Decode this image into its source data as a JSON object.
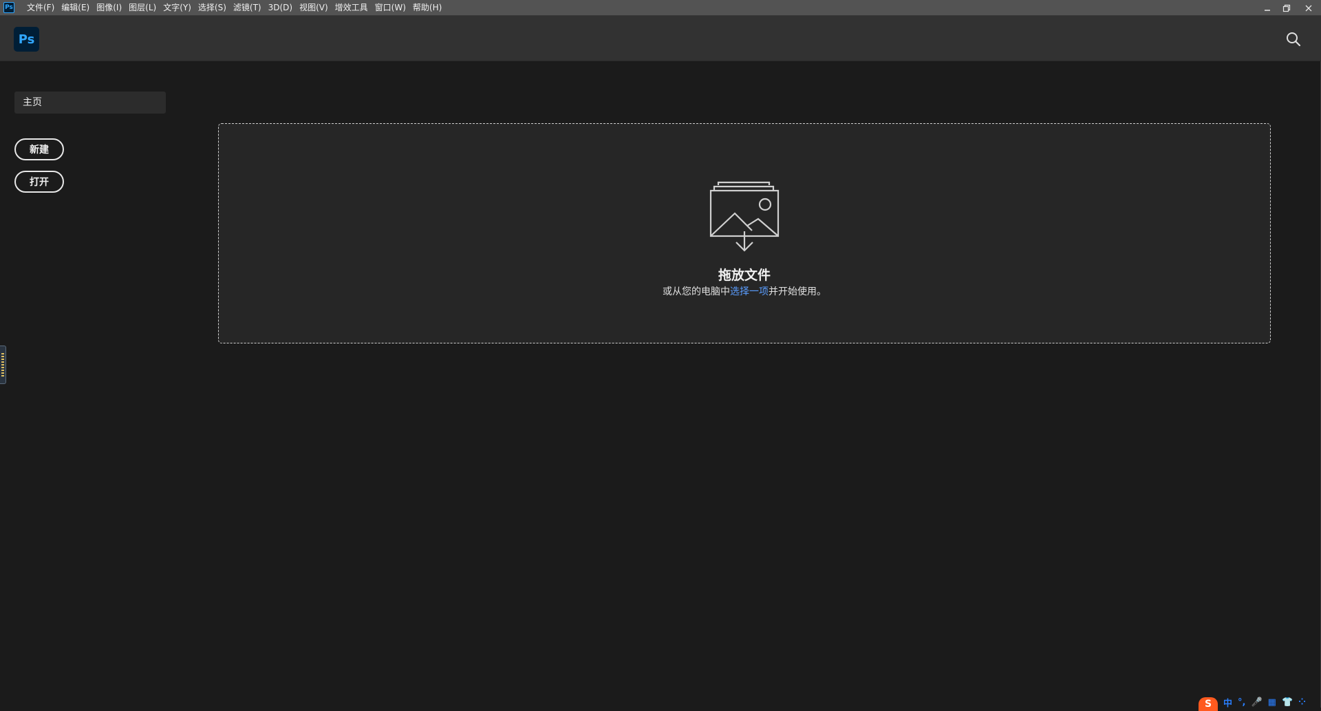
{
  "menubar": {
    "app_icon": "Ps",
    "items": [
      "文件(F)",
      "编辑(E)",
      "图像(I)",
      "图层(L)",
      "文字(Y)",
      "选择(S)",
      "滤镜(T)",
      "3D(D)",
      "视图(V)",
      "增效工具",
      "窗口(W)",
      "帮助(H)"
    ],
    "window_controls": [
      "minimize-icon",
      "restore-icon",
      "close-icon"
    ]
  },
  "header": {
    "logo": "Ps",
    "search_icon": "search-icon"
  },
  "sidebar": {
    "home_label": "主页",
    "new_label": "新建",
    "open_label": "打开"
  },
  "dropzone": {
    "icon": "image-drop-icon",
    "title": "拖放文件",
    "subtitle_pre": "或从您的电脑中",
    "subtitle_link": "选择一项",
    "subtitle_post": "并开始使用。"
  },
  "ime": {
    "logo": "S",
    "items": [
      "中",
      "°,",
      "🎤",
      "▦",
      "👕",
      "⁘"
    ]
  },
  "colors": {
    "menubar_bg": "#535353",
    "header_bg": "#323232",
    "body_bg": "#1b1b1b",
    "ps_blue": "#31a8ff",
    "ps_dark": "#001e36",
    "link": "#5a9dff"
  }
}
